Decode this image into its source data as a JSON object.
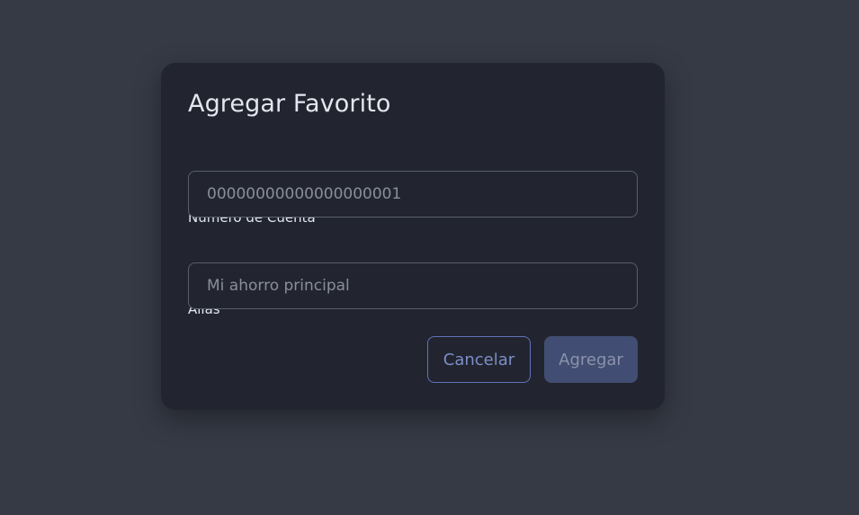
{
  "dialog": {
    "title": "Agregar Favorito",
    "fields": {
      "account": {
        "label": "Número de Cuenta",
        "placeholder": "00000000000000000001"
      },
      "alias": {
        "label": "Alias",
        "placeholder": "Mi ahorro principal"
      }
    },
    "actions": {
      "cancel_label": "Cancelar",
      "add_label": "Agregar"
    }
  },
  "colors": {
    "backdrop": "#363a45",
    "dialog_background": "#22252f",
    "accent": "#6072b8",
    "primary_disabled": "#414d72"
  }
}
